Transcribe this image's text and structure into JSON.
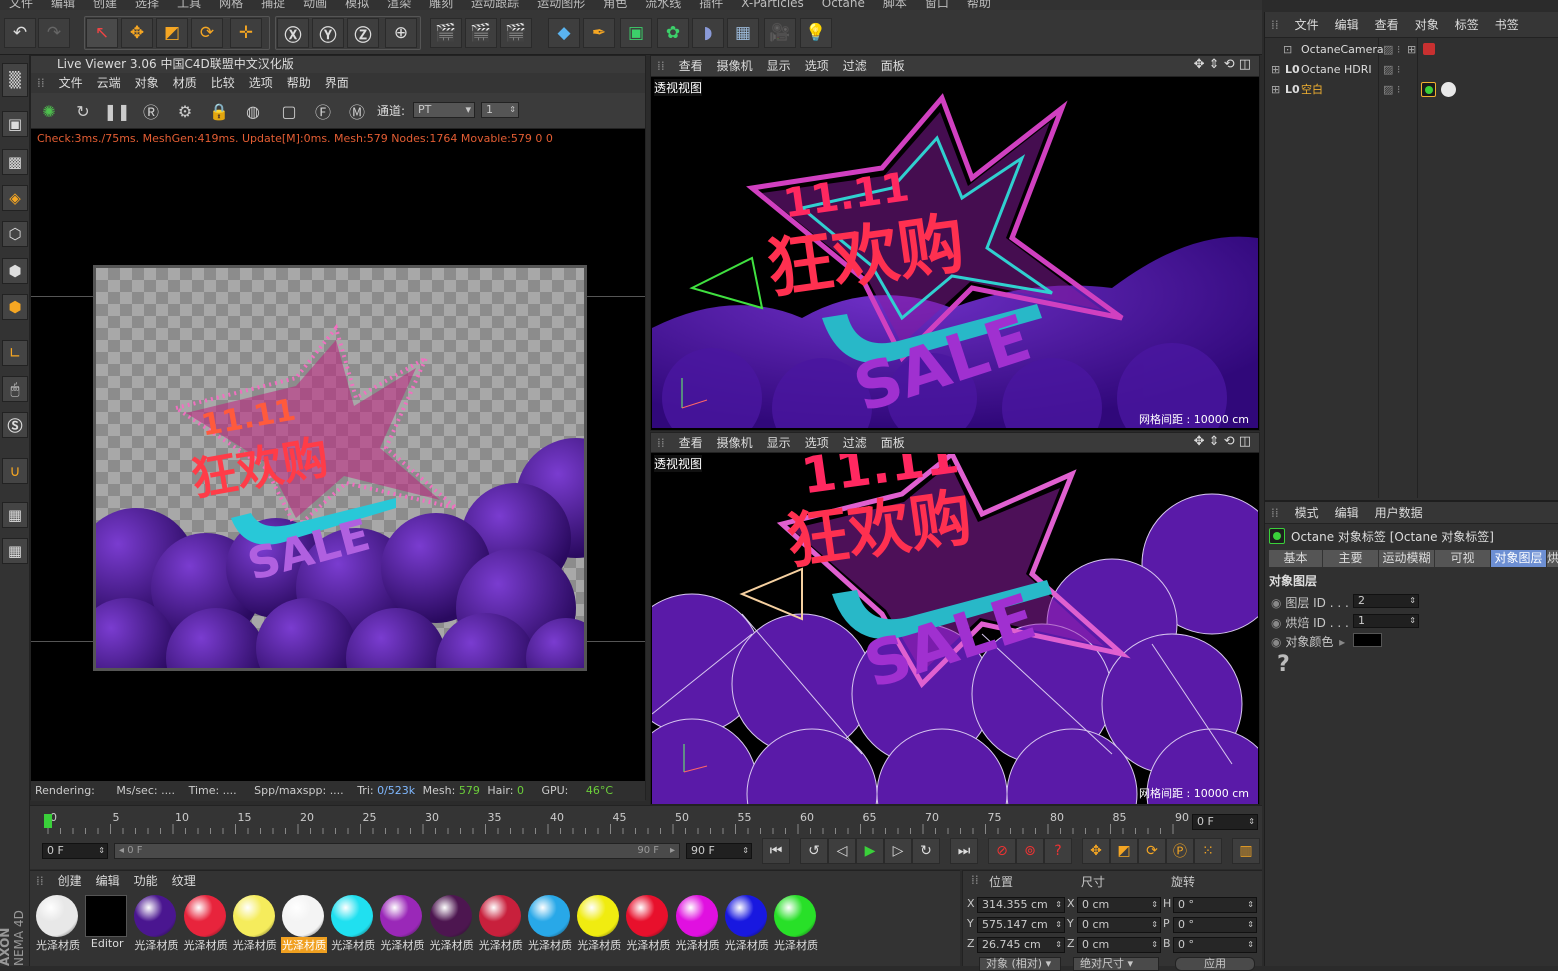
{
  "menubar": [
    "文件",
    "编辑",
    "创建",
    "选择",
    "工具",
    "网格",
    "捕捉",
    "动画",
    "模拟",
    "渲染",
    "雕刻",
    "运动跟踪",
    "运动图形",
    "角色",
    "流水线",
    "插件",
    "X-Particles",
    "Octane",
    "脚本",
    "窗口",
    "帮助"
  ],
  "live_viewer": {
    "title": "Live Viewer 3.06 中国C4D联盟中文汉化版",
    "menu": [
      "文件",
      "云端",
      "对象",
      "材质",
      "比较",
      "选项",
      "帮助",
      "界面"
    ],
    "channel_label": "通道:",
    "channel_value": "PT",
    "channel_num": "1",
    "check_text": "Check:3ms./75ms. MeshGen:419ms. Update[M]:0ms. Mesh:579 Nodes:1764 Movable:579  0 0",
    "render": {
      "label": "Rendering:",
      "mssec": "Ms/sec: ....",
      "time": "Time: ....",
      "spp": "Spp/maxspp: ....",
      "tri_label": "Tri:",
      "tri_value": "0/523k",
      "mesh_label": "Mesh:",
      "mesh_value": "579",
      "hair_label": "Hair:",
      "hair_value": "0",
      "gpu_label": "GPU:",
      "gpu_value": "46°C"
    }
  },
  "viewport_top": {
    "menu": [
      "查看",
      "摄像机",
      "显示",
      "选项",
      "过滤",
      "面板"
    ],
    "label": "透视视图",
    "grid": "网格间距 : 10000 cm"
  },
  "viewport_bottom": {
    "menu": [
      "查看",
      "摄像机",
      "显示",
      "选项",
      "过滤",
      "面板"
    ],
    "label": "透视视图",
    "grid": "网格间距 : 10000 cm"
  },
  "artwork": {
    "line1": "11.11",
    "line2": "狂欢购",
    "line3": "SALE"
  },
  "object_manager": {
    "menu": [
      "文件",
      "编辑",
      "查看",
      "对象",
      "标签",
      "书签"
    ],
    "objects": [
      {
        "name": "OctaneCamera",
        "color": "#dddddd"
      },
      {
        "name": "Octane HDRI",
        "color": "#dddddd"
      },
      {
        "name": "空白",
        "color": "#f0b030"
      }
    ]
  },
  "attributes": {
    "menu": [
      "模式",
      "编辑",
      "用户数据"
    ],
    "tag_title": "Octane 对象标签 [Octane 对象标签]",
    "tabs": [
      "基本",
      "主要",
      "运动模糊",
      "可视",
      "对象图层",
      "烘"
    ],
    "selected_tab": 4,
    "section": "对象图层",
    "fields": [
      {
        "label": "图层 ID . . . .",
        "value": "2"
      },
      {
        "label": "烘焙 ID . . . .",
        "value": "1"
      },
      {
        "label": "对象颜色",
        "value": ""
      }
    ]
  },
  "timeline": {
    "ticks": [
      "0",
      "5",
      "10",
      "15",
      "20",
      "25",
      "30",
      "35",
      "40",
      "45",
      "50",
      "55",
      "60",
      "65",
      "70",
      "75",
      "80",
      "85",
      "90"
    ],
    "current_frame": "0 F",
    "start": "0 F",
    "slider_left": "0 F",
    "slider_right": "90 F",
    "end": "90 F"
  },
  "material_manager": {
    "menu": [
      "创建",
      "编辑",
      "功能",
      "纹理"
    ],
    "materials": [
      {
        "label": "光泽材质",
        "color": "#e8e8e8"
      },
      {
        "label": "Editor",
        "color": "#000000"
      },
      {
        "label": "光泽材质",
        "color": "#4a1690"
      },
      {
        "label": "光泽材质",
        "color": "#e8243c"
      },
      {
        "label": "光泽材质",
        "color": "#f5ec5c"
      },
      {
        "label": "光泽材质",
        "color": "#f4f4f4"
      },
      {
        "label": "光泽材质",
        "color": "#20e0f0"
      },
      {
        "label": "光泽材质",
        "color": "#9a28b8"
      },
      {
        "label": "光泽材质",
        "color": "#4d1650"
      },
      {
        "label": "光泽材质",
        "color": "#c8203c"
      },
      {
        "label": "光泽材质",
        "color": "#28a8e8"
      },
      {
        "label": "光泽材质",
        "color": "#f0ec10"
      },
      {
        "label": "光泽材质",
        "color": "#e8102c"
      },
      {
        "label": "光泽材质",
        "color": "#e010e0"
      },
      {
        "label": "光泽材质",
        "color": "#1818e0"
      },
      {
        "label": "光泽材质",
        "color": "#28e028"
      }
    ],
    "selected": 5
  },
  "coordinates": {
    "headers": [
      "位置",
      "尺寸",
      "旋转"
    ],
    "rows": [
      {
        "axis": "X",
        "pos": "314.355 cm",
        "sax": "X",
        "size": "0 cm",
        "rax": "H",
        "rot": "0 °"
      },
      {
        "axis": "Y",
        "pos": "575.147 cm",
        "sax": "Y",
        "size": "0 cm",
        "rax": "P",
        "rot": "0 °"
      },
      {
        "axis": "Z",
        "pos": "26.745 cm",
        "sax": "Z",
        "size": "0 cm",
        "rax": "B",
        "rot": "0 °"
      }
    ],
    "btn1": "对象 (相对)",
    "btn2": "绝对尺寸",
    "apply": "应用"
  },
  "brand": {
    "line1": "AXON",
    "line2": "NEMA 4D"
  },
  "colors": {
    "accent_blue": "#6d8fd3",
    "orange_text": "#e35d33",
    "green_text": "#6ccf3a",
    "purple_bg": "#4a1690",
    "magenta": "#d4208c"
  }
}
